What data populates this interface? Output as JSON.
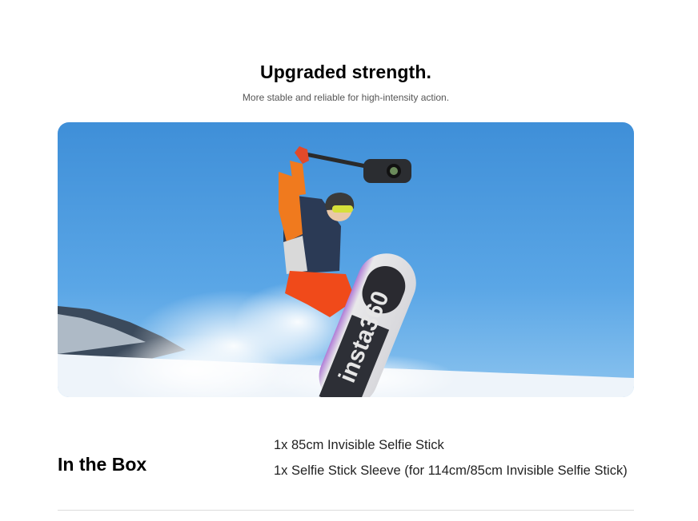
{
  "hero": {
    "title": "Upgraded strength.",
    "subtitle": "More stable and reliable for high-intensity action."
  },
  "photo": {
    "board_logo_text": "insta360",
    "sky_color": "#4a9be0",
    "jacket_color": "#f07a1e",
    "pants_color": "#f04a1a"
  },
  "in_the_box": {
    "heading": "In the Box",
    "items": [
      "1x 85cm Invisible Selfie Stick",
      "1x Selfie Stick Sleeve (for 114cm/85cm Invisible Selfie Stick)"
    ]
  }
}
